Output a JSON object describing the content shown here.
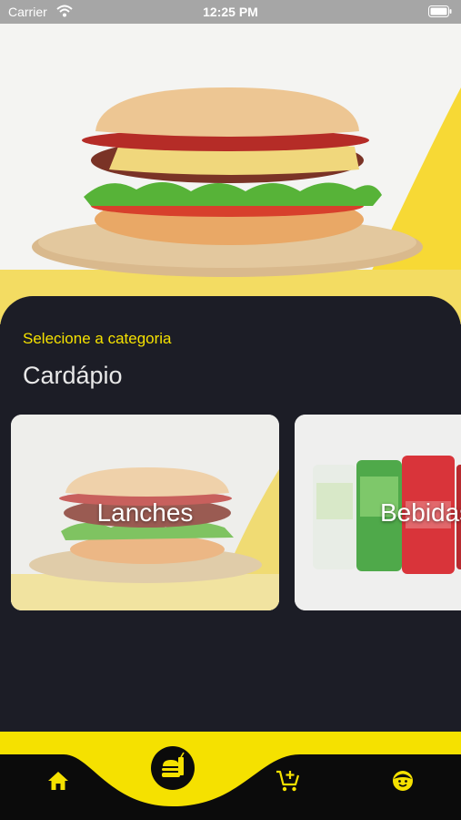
{
  "status_bar": {
    "carrier": "Carrier",
    "time": "12:25 PM"
  },
  "header": {
    "subtitle": "Selecione a categoria",
    "title": "Cardápio"
  },
  "categories": [
    {
      "label": "Lanches",
      "icon": "burger-image"
    },
    {
      "label": "Bebidas",
      "icon": "drinks-image"
    }
  ],
  "tab_bar": {
    "active": "menu",
    "items": [
      {
        "name": "home",
        "icon": "home-icon"
      },
      {
        "name": "menu",
        "icon": "burger-icon"
      },
      {
        "name": "cart",
        "icon": "cart-add-icon"
      },
      {
        "name": "profile",
        "icon": "smiley-icon"
      }
    ]
  },
  "colors": {
    "accent": "#f5e100",
    "panel": "#1c1d26",
    "tab_bar": "#0b0b0b"
  }
}
